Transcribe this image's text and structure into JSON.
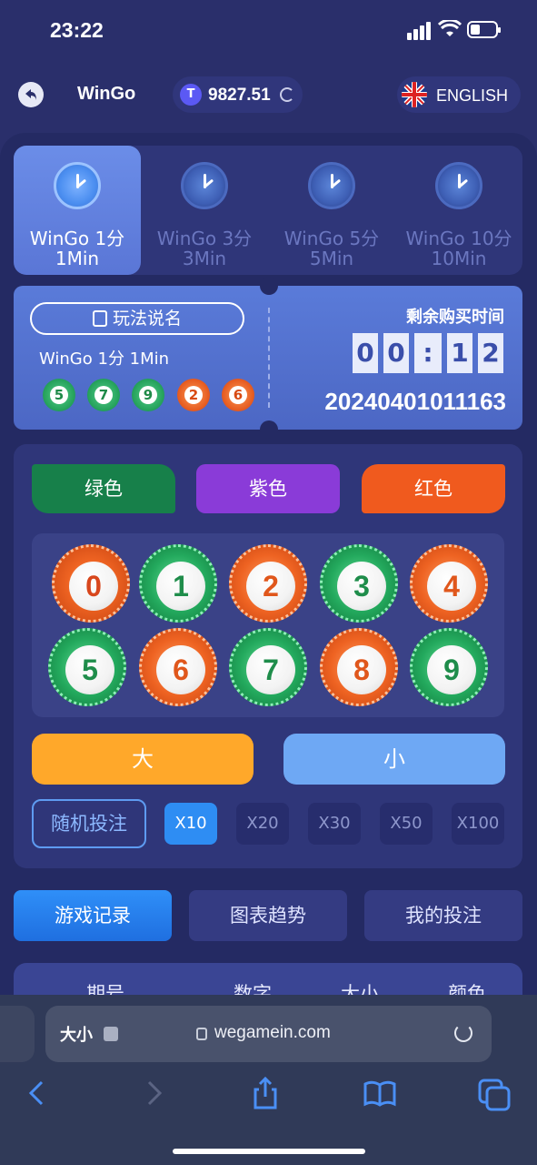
{
  "status": {
    "time": "23:22"
  },
  "header": {
    "title": "WinGo",
    "balance": "9827.51",
    "coin_symbol": "T",
    "language": "ENGLISH"
  },
  "tabs": [
    {
      "line1": "WinGo 1分",
      "line2": "1Min",
      "active": true
    },
    {
      "line1": "WinGo 3分",
      "line2": "3Min",
      "active": false
    },
    {
      "line1": "WinGo 5分",
      "line2": "5Min",
      "active": false
    },
    {
      "line1": "WinGo 10分",
      "line2": "10Min",
      "active": false
    }
  ],
  "ticket": {
    "how_to_play": "玩法说名",
    "game_name": "WinGo 1分 1Min",
    "recent": [
      {
        "num": "5",
        "color": "green"
      },
      {
        "num": "7",
        "color": "green"
      },
      {
        "num": "9",
        "color": "green"
      },
      {
        "num": "2",
        "color": "red"
      },
      {
        "num": "6",
        "color": "red"
      }
    ],
    "remaining_label": "剩余购买时间",
    "countdown": [
      "0",
      "0",
      ":",
      "1",
      "2"
    ],
    "issue_number": "20240401011163"
  },
  "bet": {
    "colors": {
      "green": "绿色",
      "violet": "紫色",
      "red": "红色"
    },
    "numbers": [
      "0",
      "1",
      "2",
      "3",
      "4",
      "5",
      "6",
      "7",
      "8",
      "9"
    ],
    "big": "大",
    "small": "小",
    "random": "随机投注",
    "multipliers": [
      "X10",
      "X20",
      "X30",
      "X50",
      "X100"
    ]
  },
  "bottom_tabs": [
    "游戏记录",
    "图表趋势",
    "我的投注"
  ],
  "table": {
    "headers": [
      "期号",
      "数字",
      "大小",
      "颜色"
    ]
  },
  "browser": {
    "text_size": "大小",
    "url": "wegamein.com"
  },
  "theme_colors": {
    "green": "#17804a",
    "violet": "#8a3bd8",
    "red": "#f05a1e",
    "big": "#ffa82a",
    "small": "#6ea8f4",
    "accent": "#2e8df3"
  }
}
